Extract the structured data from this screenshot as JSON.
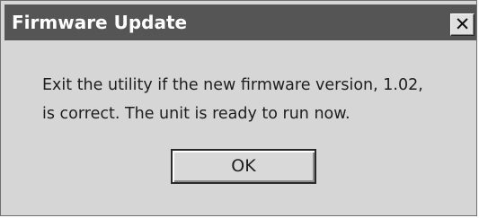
{
  "window": {
    "title": "Firmware Update",
    "close_glyph": "✕",
    "close_icon": "close-icon"
  },
  "message": {
    "line1": "Exit the utility if the new firmware version,  1.02,",
    "line2": "is correct. The unit is ready to run now."
  },
  "buttons": {
    "ok_label": "OK"
  },
  "colors": {
    "titlebar": "#555555",
    "dialog_bg": "#d6d6d6",
    "text": "#1e1e1e"
  }
}
